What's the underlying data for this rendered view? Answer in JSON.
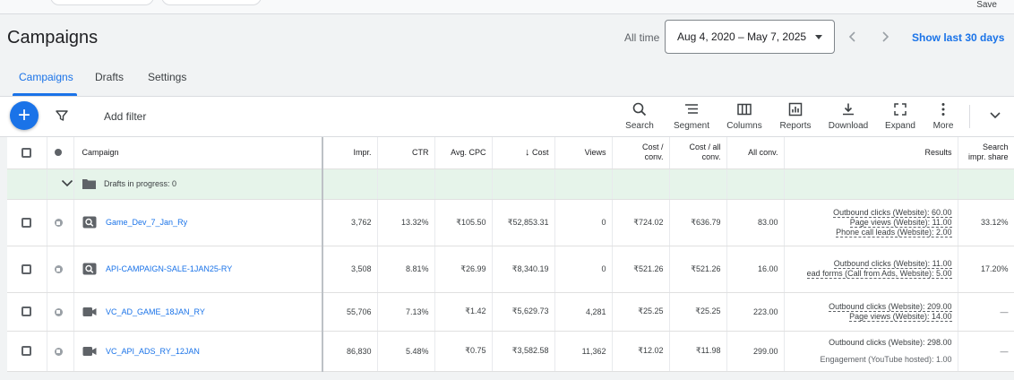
{
  "header": {
    "save_label": "Save",
    "title": "Campaigns",
    "all_time_label": "All time",
    "date_range": "Aug 4, 2020 – May 7, 2025",
    "show_last": "Show last 30 days"
  },
  "tabs": [
    {
      "label": "Campaigns",
      "active": true
    },
    {
      "label": "Drafts",
      "active": false
    },
    {
      "label": "Settings",
      "active": false
    }
  ],
  "toolbar": {
    "add_filter": "Add filter",
    "tools": [
      {
        "label": "Search",
        "icon": "search-icon"
      },
      {
        "label": "Segment",
        "icon": "segment-icon"
      },
      {
        "label": "Columns",
        "icon": "columns-icon"
      },
      {
        "label": "Reports",
        "icon": "reports-icon"
      },
      {
        "label": "Download",
        "icon": "download-icon"
      },
      {
        "label": "Expand",
        "icon": "expand-icon"
      },
      {
        "label": "More",
        "icon": "more-icon"
      }
    ]
  },
  "table": {
    "headers": {
      "campaign": "Campaign",
      "impr": "Impr.",
      "ctr": "CTR",
      "avg_cpc": "Avg. CPC",
      "cost": "Cost",
      "views": "Views",
      "cost_conv_1": "Cost /",
      "cost_conv_2": "conv.",
      "cost_all_conv_1": "Cost / all",
      "cost_all_conv_2": "conv.",
      "all_conv": "All conv.",
      "results": "Results",
      "search_share_1": "Search",
      "search_share_2": "impr. share"
    },
    "drafts_label": "Drafts in progress: 0",
    "rows": [
      {
        "name": "Game_Dev_7_Jan_Ry",
        "type": "search",
        "impr": "3,762",
        "ctr": "13.32%",
        "avg_cpc": "₹105.50",
        "cost": "₹52,853.31",
        "views": "0",
        "cost_conv": "₹724.02",
        "cost_all_conv": "₹636.79",
        "all_conv": "83.00",
        "results": [
          "Outbound clicks (Website): 60.00",
          "Page views (Website): 11.00",
          "Phone call leads (Website): 2.00"
        ],
        "search_share": "33.12%"
      },
      {
        "name": "API-CAMPAIGN-SALE-1JAN25-RY",
        "type": "search",
        "impr": "3,508",
        "ctr": "8.81%",
        "avg_cpc": "₹26.99",
        "cost": "₹8,340.19",
        "views": "0",
        "cost_conv": "₹521.26",
        "cost_all_conv": "₹521.26",
        "all_conv": "16.00",
        "results": [
          "Outbound clicks (Website): 11.00",
          "ead forms (Call from Ads, Website): 5.00"
        ],
        "search_share": "17.20%"
      },
      {
        "name": "VC_AD_GAME_18JAN_RY",
        "type": "video",
        "impr": "55,706",
        "ctr": "7.13%",
        "avg_cpc": "₹1.42",
        "cost": "₹5,629.73",
        "views": "4,281",
        "cost_conv": "₹25.25",
        "cost_all_conv": "₹25.25",
        "all_conv": "223.00",
        "results": [
          "Outbound clicks (Website): 209.00",
          "Page views (Website): 14.00"
        ],
        "search_share": "—"
      },
      {
        "name": "VC_API_ADS_RY_12JAN",
        "type": "video",
        "impr": "86,830",
        "ctr": "5.48%",
        "avg_cpc": "₹0.75",
        "cost": "₹3,582.58",
        "views": "11,362",
        "cost_conv": "₹12.02",
        "cost_all_conv": "₹11.98",
        "all_conv": "299.00",
        "results": [
          "Outbound clicks (Website): 298.00",
          "Engagement (YouTube hosted): 1.00"
        ],
        "search_share": "—"
      }
    ]
  },
  "colors": {
    "accent": "#1a73e8",
    "drafts_row_bg": "#e6f4ea",
    "page_bg": "#f1f3f4"
  }
}
